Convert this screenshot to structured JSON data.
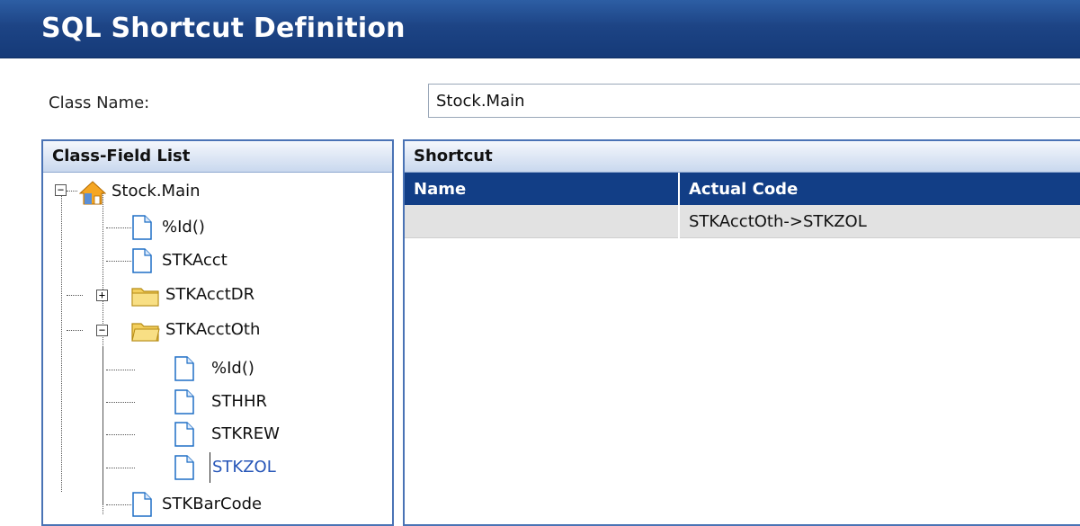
{
  "window": {
    "title": "SQL Shortcut Definition"
  },
  "form": {
    "class_name_label": "Class Name:",
    "class_name_value": "Stock.Main"
  },
  "class_field_list": {
    "header": "Class-Field List",
    "root": "Stock.Main",
    "items": [
      "%Id()",
      "STKAcct",
      "STKAcctDR",
      "STKAcctOth",
      "%Id()",
      "STHHR",
      "STKREW",
      "STKZOL",
      "STKBarCode"
    ]
  },
  "shortcut": {
    "header": "Shortcut",
    "columns": [
      "Name",
      "Actual Code"
    ],
    "rows": [
      {
        "name": "",
        "actual_code": "STKAcctOth->STKZOL"
      }
    ]
  },
  "icons": {
    "root": "house-icon",
    "field": "document-icon",
    "folder": "folder-icon"
  },
  "colors": {
    "title_bar": "#1d4485",
    "grid_header": "#123e86",
    "selection": "#2756b8"
  }
}
